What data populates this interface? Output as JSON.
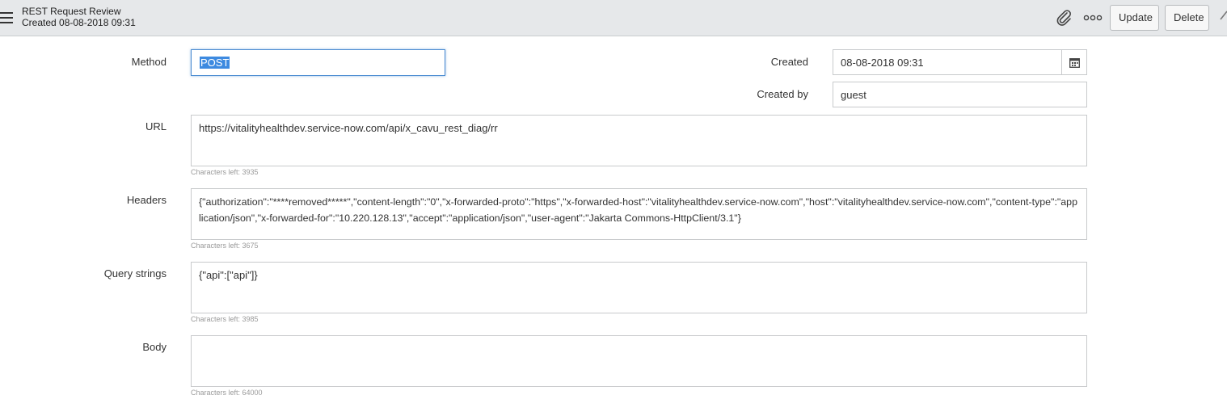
{
  "header": {
    "title": "REST Request Review",
    "subtitle": "Created 08-08-2018 09:31",
    "menu_icon": "hamburger-menu-icon",
    "attachment_icon": "paperclip-icon",
    "more_icon": "more-options-icon",
    "update_label": "Update",
    "delete_label": "Delete"
  },
  "form": {
    "method": {
      "label": "Method",
      "value": "POST"
    },
    "created": {
      "label": "Created",
      "value": "08-08-2018 09:31",
      "icon": "calendar-icon"
    },
    "created_by": {
      "label": "Created by",
      "value": "guest"
    },
    "url": {
      "label": "URL",
      "value": "https://vitalityhealthdev.service-now.com/api/x_cavu_rest_diag/rr",
      "hint": "Characters left: 3935"
    },
    "headers": {
      "label": "Headers",
      "value": "{\"authorization\":\"****removed*****\",\"content-length\":\"0\",\"x-forwarded-proto\":\"https\",\"x-forwarded-host\":\"vitalityhealthdev.service-now.com\",\"host\":\"vitalityhealthdev.service-now.com\",\"content-type\":\"application/json\",\"x-forwarded-for\":\"10.220.128.13\",\"accept\":\"application/json\",\"user-agent\":\"Jakarta Commons-HttpClient/3.1\"}",
      "hint": "Characters left: 3675"
    },
    "query_strings": {
      "label": "Query strings",
      "value": "{\"api\":[\"api\"]}",
      "hint": "Characters left: 3985"
    },
    "body": {
      "label": "Body",
      "value": "",
      "hint": "Characters left: 64000"
    }
  },
  "colors": {
    "header_bg": "#e6e8ea",
    "focus_border": "#4a8bd1",
    "selection": "#3d8ae0"
  }
}
